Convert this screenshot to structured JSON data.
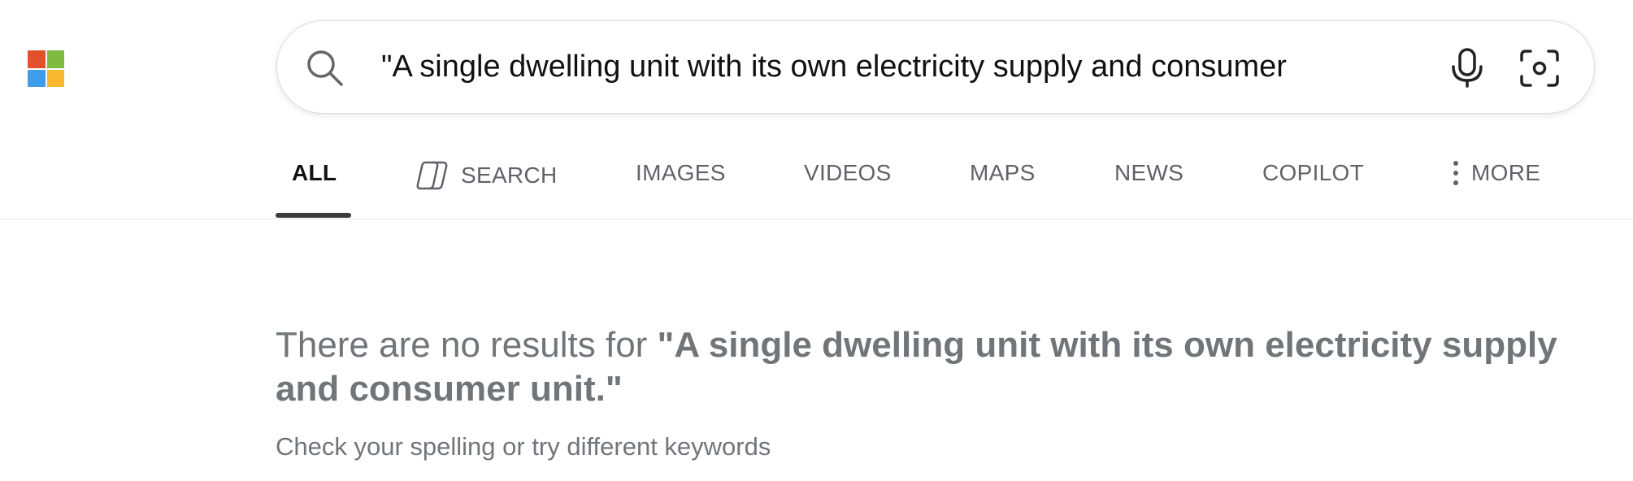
{
  "brand": {
    "logo_colors": [
      "#e2502e",
      "#7dba3f",
      "#3e9ce8",
      "#f7b72f"
    ]
  },
  "search": {
    "value": "\"A single dwelling unit with its own electricity supply and consumer",
    "icons": [
      "search-icon",
      "microphone-icon",
      "visual-search-icon"
    ]
  },
  "tabs": {
    "all": "ALL",
    "search": "SEARCH",
    "images": "IMAGES",
    "videos": "VIDEOS",
    "maps": "MAPS",
    "news": "NEWS",
    "copilot": "COPILOT",
    "more": "MORE",
    "active": "ALL"
  },
  "message": {
    "prefix": "There are no results for ",
    "query": "\"A single dwelling unit with its own electricity supply and consumer unit.\"",
    "hint": "Check your spelling or try different keywords"
  },
  "colors": {
    "text_muted": "#70757a",
    "active_underline": "#3b3b3b"
  }
}
